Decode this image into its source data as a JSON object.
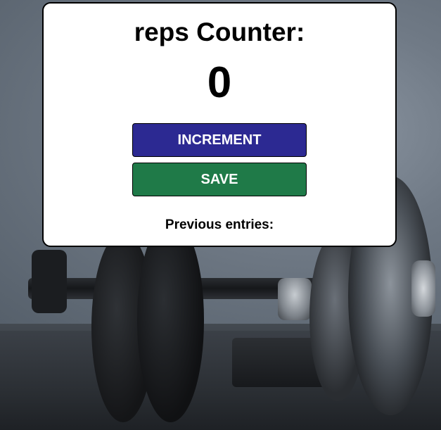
{
  "counter": {
    "title": "reps Counter:",
    "value": "0"
  },
  "buttons": {
    "increment_label": "INCREMENT",
    "save_label": "SAVE"
  },
  "history": {
    "label": "Previous entries:",
    "entries": []
  },
  "colors": {
    "increment_button": "#2c2992",
    "save_button": "#1f7a48",
    "card_background": "#ffffff",
    "card_border": "#000000"
  },
  "background_image": "dumbbell-photo"
}
